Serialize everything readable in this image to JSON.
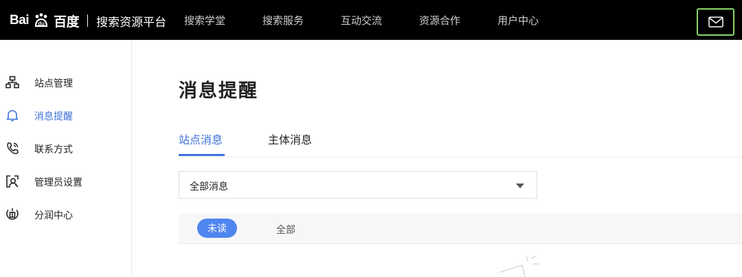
{
  "header": {
    "brand_prefix": "Bai",
    "brand_suffix": "百度",
    "platform_title": "搜索资源平台",
    "nav": [
      "搜索学堂",
      "搜索服务",
      "互动交流",
      "资源合作",
      "用户中心"
    ],
    "mail_icon": "mail-icon"
  },
  "sidebar": {
    "items": [
      {
        "label": "站点管理",
        "icon": "sitemap-icon",
        "active": false
      },
      {
        "label": "消息提醒",
        "icon": "bell-icon",
        "active": true
      },
      {
        "label": "联系方式",
        "icon": "phone-icon",
        "active": false
      },
      {
        "label": "管理员设置",
        "icon": "admin-icon",
        "active": false
      },
      {
        "label": "分润中心",
        "icon": "share-icon",
        "active": false
      }
    ]
  },
  "main": {
    "title": "消息提醒",
    "tabs": [
      {
        "label": "站点消息",
        "active": true
      },
      {
        "label": "主体消息",
        "active": false
      }
    ],
    "select": {
      "value": "全部消息"
    },
    "filters": {
      "unread": "未读",
      "all": "全部"
    }
  },
  "colors": {
    "accent": "#3d6fd8",
    "pill": "#4f86f0",
    "highlight": "#8bd66a"
  }
}
